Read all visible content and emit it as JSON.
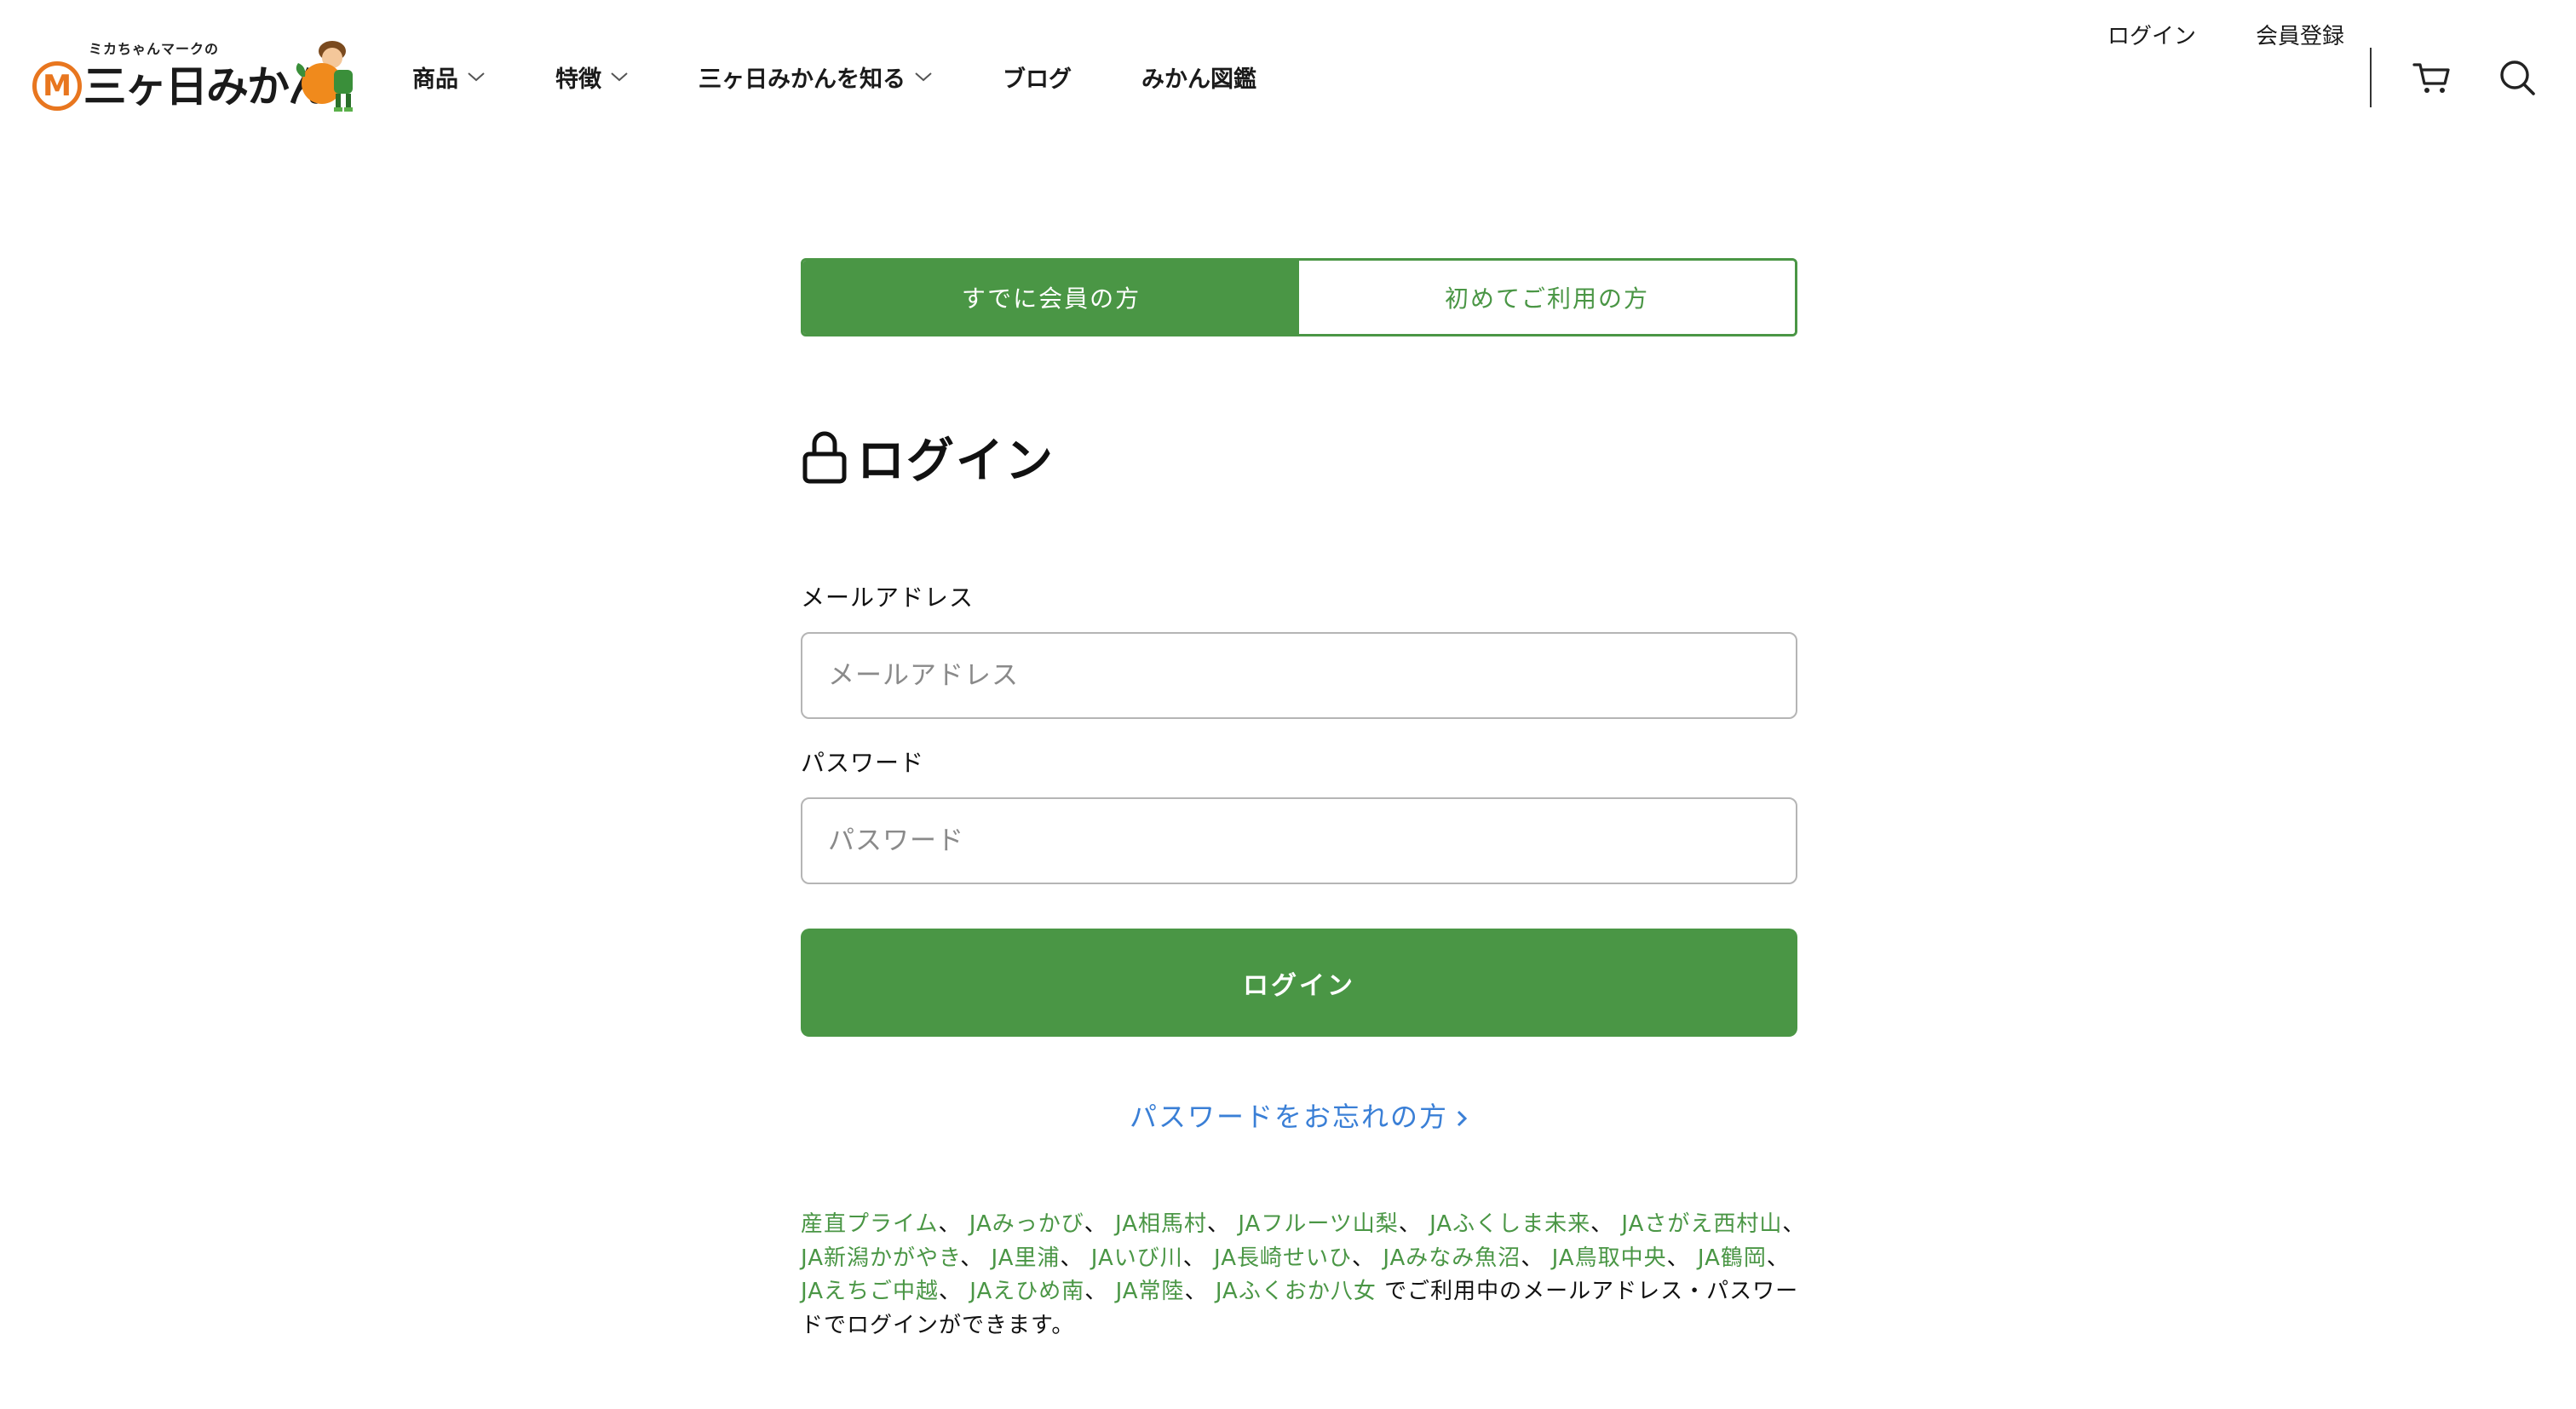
{
  "header": {
    "logo_tagline": "ミカちゃんマークの",
    "logo_mark": "M",
    "logo_text": "三ヶ日みかん",
    "nav": [
      {
        "label": "商品",
        "has_dropdown": true
      },
      {
        "label": "特徴",
        "has_dropdown": true
      },
      {
        "label": "三ヶ日みかんを知る",
        "has_dropdown": true
      },
      {
        "label": "ブログ",
        "has_dropdown": false
      },
      {
        "label": "みかん図鑑",
        "has_dropdown": false
      }
    ],
    "login_link": "ログイン",
    "register_link": "会員登録",
    "cart_icon": "cart-icon",
    "search_icon": "search-icon"
  },
  "tabs": {
    "member": "すでに会員の方",
    "first_time": "初めてご利用の方",
    "active": "member"
  },
  "form": {
    "title": "ログイン",
    "title_icon": "lock-icon",
    "email_label": "メールアドレス",
    "email_placeholder": "メールアドレス",
    "email_value": "",
    "password_label": "パスワード",
    "password_placeholder": "パスワード",
    "password_value": "",
    "submit_label": "ログイン",
    "forgot_link": "パスワードをお忘れの方"
  },
  "notice": {
    "partners": [
      "産直プライム",
      "JAみっかび",
      "JA相馬村",
      "JAフルーツ山梨",
      "JAふくしま未来",
      "JAさがえ西村山",
      "JA新潟かがやき",
      "JA里浦",
      "JAいび川",
      "JA長崎せいひ",
      "JAみなみ魚沼",
      "JA鳥取中央",
      "JA鶴岡",
      "JAえちご中越",
      "JAえひめ南",
      "JA常陸",
      "JAふくおか八女"
    ],
    "separator": "、",
    "suffix": "でご利用中のメールアドレス・パスワードでログインができます。"
  },
  "colors": {
    "brand_green": "#4a9645",
    "link_blue": "#3a7fd6",
    "logo_orange": "#e8761f"
  }
}
